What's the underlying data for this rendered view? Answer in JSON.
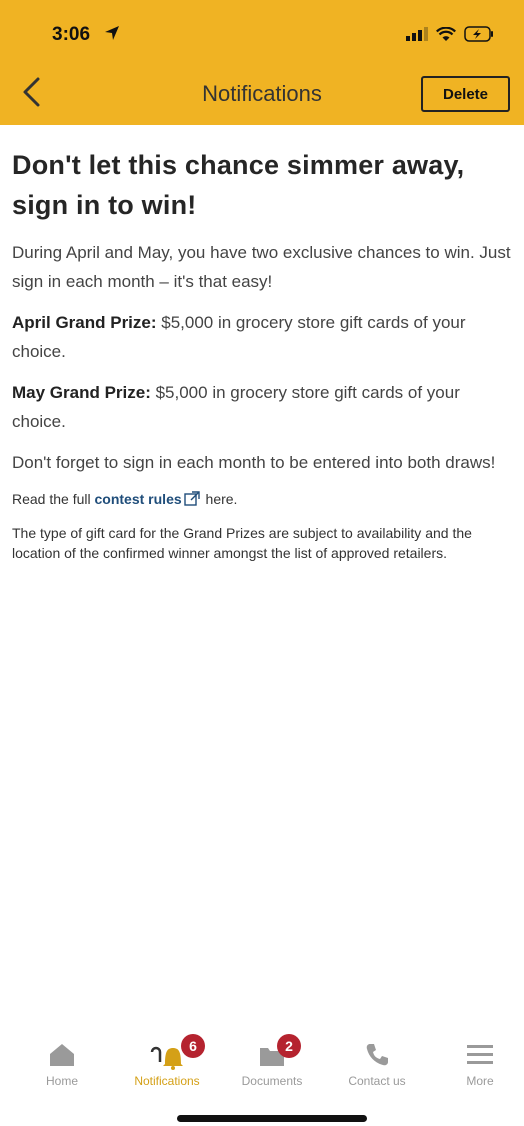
{
  "status": {
    "time": "3:06"
  },
  "nav": {
    "title": "Notifications",
    "delete_label": "Delete"
  },
  "article": {
    "title": "Don't let this chance simmer away, sign in to win!",
    "intro": "During April and May, you have two exclusive chances to win. Just sign in each month – it's that easy!",
    "april_label": "April Grand Prize:",
    "april_text": " $5,000 in grocery store gift cards of your choice.",
    "may_label": "May Grand Prize:",
    "may_text": " $5,000 in grocery store gift cards of your choice.",
    "reminder": "Don't forget to sign in each month to be entered into both draws!",
    "rules_prefix": "Read the full ",
    "rules_link": "contest rules",
    "rules_suffix": " here.",
    "disclaimer": "The type of gift card for the Grand Prizes are subject to availability and the location of the confirmed winner amongst the list of approved retailers."
  },
  "tabs": [
    {
      "label": "Home",
      "icon": "home-icon"
    },
    {
      "label": "Notifications",
      "icon": "bell-icon",
      "badge": "6"
    },
    {
      "label": "Documents",
      "icon": "folder-icon",
      "badge": "2"
    },
    {
      "label": "Contact us",
      "icon": "phone-icon"
    },
    {
      "label": "More",
      "icon": "menu-icon"
    }
  ],
  "colors": {
    "header": "#f0b323",
    "badge": "#b5232f",
    "link": "#1f4d7a",
    "active_tab": "#d4a017"
  }
}
